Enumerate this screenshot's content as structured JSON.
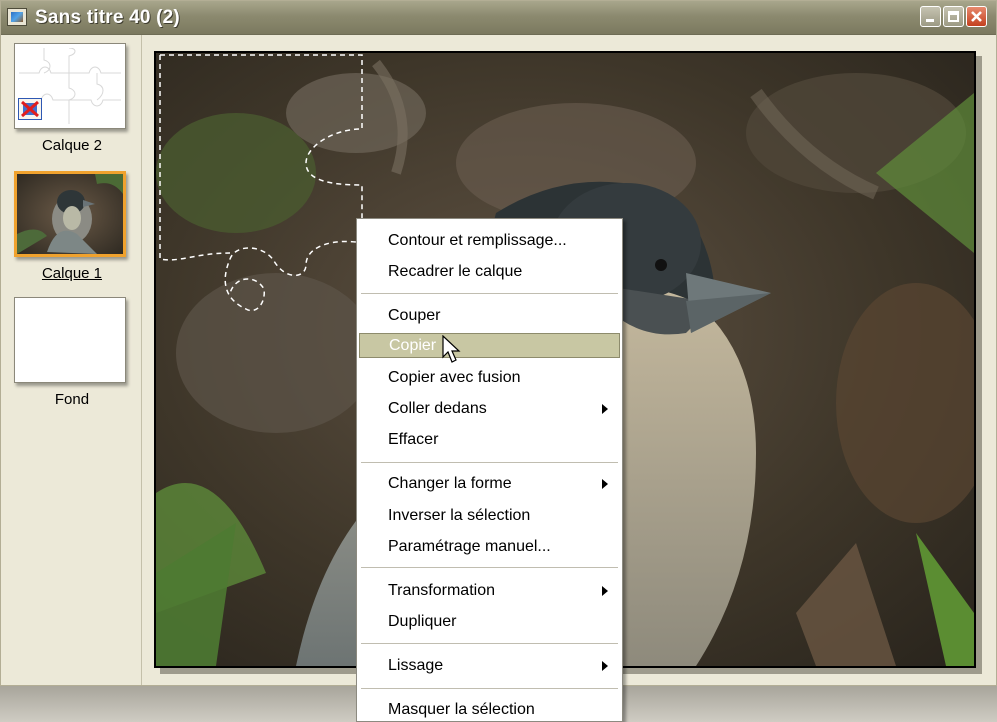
{
  "window": {
    "title": "Sans titre 40 (2)"
  },
  "layers": [
    {
      "name": "Calque 2",
      "active": false
    },
    {
      "name": "Calque 1",
      "active": true
    },
    {
      "name": "Fond",
      "active": false
    }
  ],
  "context_menu": {
    "items": [
      {
        "label": "Contour et remplissage..."
      },
      {
        "label": "Recadrer le calque"
      },
      {
        "label": "Couper"
      },
      {
        "label": "Copier",
        "highlighted": true
      },
      {
        "label": "Copier avec fusion"
      },
      {
        "label": "Coller dedans",
        "submenu": true
      },
      {
        "label": "Effacer"
      },
      {
        "label": "Changer la forme",
        "submenu": true
      },
      {
        "label": "Inverser la sélection"
      },
      {
        "label": "Paramétrage manuel..."
      },
      {
        "label": "Transformation",
        "submenu": true
      },
      {
        "label": "Dupliquer"
      },
      {
        "label": "Lissage",
        "submenu": true
      },
      {
        "label": "Masquer la sélection"
      }
    ]
  },
  "colors": {
    "layer_selected_border": "#f0a22e",
    "menu_highlight": "#c8c7a3",
    "selection_marquee": "#ffffff"
  },
  "icons": {
    "layer_hidden": "hidden-layer-icon",
    "window_controls": [
      "minimize-icon",
      "maximize-icon",
      "close-icon"
    ]
  }
}
